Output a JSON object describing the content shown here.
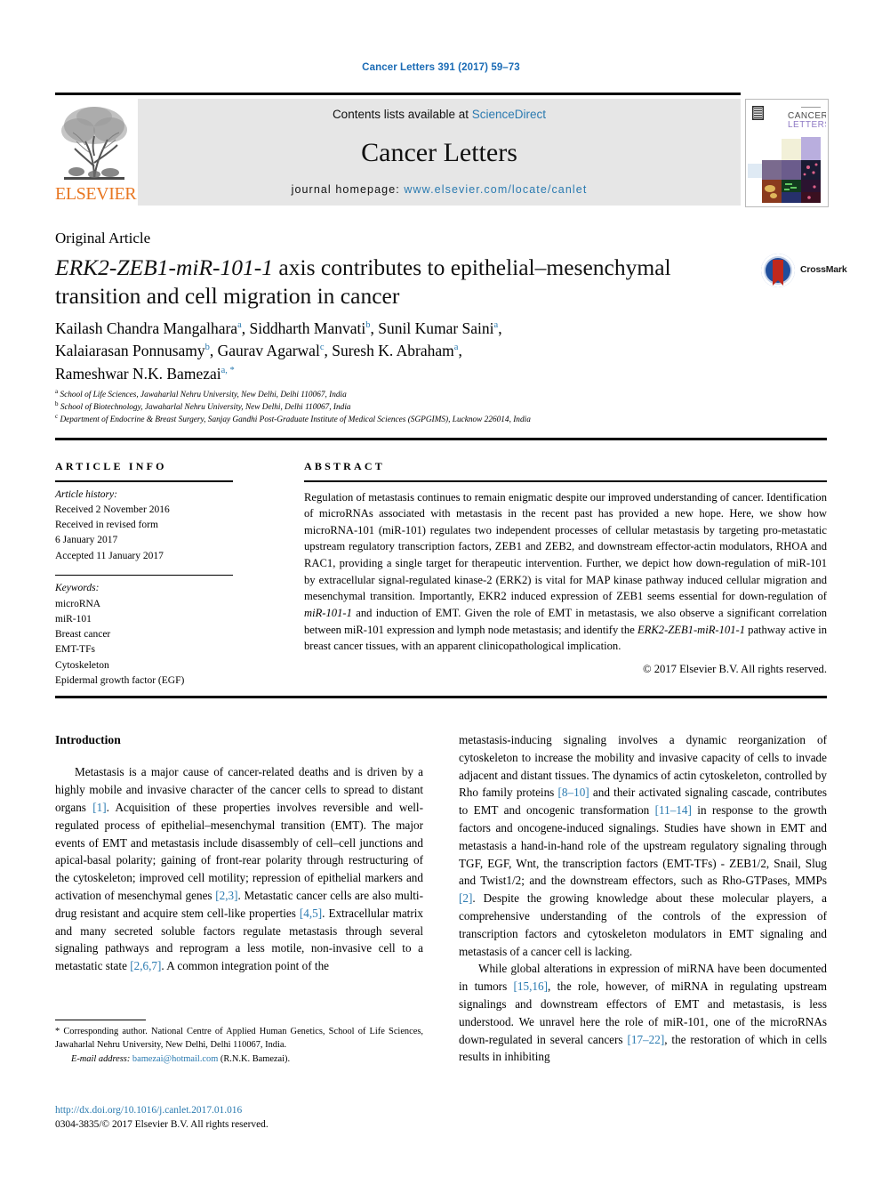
{
  "running_head": "Cancer Letters 391 (2017) 59–73",
  "masthead": {
    "contents_prefix": "Contents lists available at ",
    "contents_link": "ScienceDirect",
    "journal_title": "Cancer Letters",
    "homepage_prefix": "journal homepage: ",
    "homepage_url": "www.elsevier.com/locate/canlet",
    "publisher": "ELSEVIER",
    "cover_title_line1": "CANCER",
    "cover_title_line2": "LETTERS"
  },
  "article": {
    "type": "Original Article",
    "title_italic": "ERK2-ZEB1-miR-101-1",
    "title_rest": " axis contributes to epithelial–mesenchymal transition and cell migration in cancer",
    "crossmark_label": "CrossMark"
  },
  "authors": [
    {
      "name": "Kailash Chandra Mangalhara",
      "sup": "a"
    },
    {
      "name": "Siddharth Manvati",
      "sup": "b"
    },
    {
      "name": "Sunil Kumar Saini",
      "sup": "a"
    },
    {
      "name": "Kalaiarasan Ponnusamy",
      "sup": "b"
    },
    {
      "name": "Gaurav Agarwal",
      "sup": "c"
    },
    {
      "name": "Suresh K. Abraham",
      "sup": "a"
    },
    {
      "name": "Rameshwar N.K. Bamezai",
      "sup": "a, *"
    }
  ],
  "affiliations": [
    {
      "marker": "a",
      "text": "School of Life Sciences, Jawaharlal Nehru University, New Delhi, Delhi 110067, India"
    },
    {
      "marker": "b",
      "text": "School of Biotechnology, Jawaharlal Nehru University, New Delhi, Delhi 110067, India"
    },
    {
      "marker": "c",
      "text": "Department of Endocrine & Breast Surgery, Sanjay Gandhi Post-Graduate Institute of Medical Sciences (SGPGIMS), Lucknow 226014, India"
    }
  ],
  "article_info": {
    "heading": "ARTICLE INFO",
    "history_label": "Article history:",
    "history": [
      "Received 2 November 2016",
      "Received in revised form",
      "6 January 2017",
      "Accepted 11 January 2017"
    ],
    "keywords_label": "Keywords:",
    "keywords": [
      "microRNA",
      "miR-101",
      "Breast cancer",
      "EMT-TFs",
      "Cytoskeleton",
      "Epidermal growth factor (EGF)"
    ]
  },
  "abstract": {
    "heading": "ABSTRACT",
    "part1": "Regulation of metastasis continues to remain enigmatic despite our improved understanding of cancer. Identification of microRNAs associated with metastasis in the recent past has provided a new hope. Here, we show how microRNA-101 (miR-101) regulates two independent processes of cellular metastasis by targeting pro-metastatic upstream regulatory transcription factors, ZEB1 and ZEB2, and downstream effector-actin modulators, RHOA and RAC1, providing a single target for therapeutic intervention. Further, we depict how down-regulation of miR-101 by extracellular signal-regulated kinase-2 (ERK2) is vital for MAP kinase pathway induced cellular migration and mesenchymal transition. Importantly, EKR2 induced expression of ZEB1 seems essential for down-regulation of ",
    "italic1": "miR-101-1",
    "part2": " and induction of EMT. Given the role of EMT in metastasis, we also observe a significant correlation between miR-101 expression and lymph node metastasis; and identify the ",
    "italic2": "ERK2-ZEB1-miR-101-1",
    "part3": " pathway active in breast cancer tissues, with an apparent clinicopathological implication.",
    "copyright": "© 2017 Elsevier B.V. All rights reserved."
  },
  "body": {
    "section_title": "Introduction",
    "left_paragraph_1": {
      "s1": "Metastasis is a major cause of cancer-related deaths and is driven by a highly mobile and invasive character of the cancer cells to spread to distant organs ",
      "r1": "[1]",
      "s2": ". Acquisition of these properties involves reversible and well-regulated process of epithelial–mesenchymal transition (EMT). The major events of EMT and metastasis include disassembly of cell–cell junctions and apical-basal polarity; gaining of front-rear polarity through restructuring of the cytoskeleton; improved cell motility; repression of epithelial markers and activation of mesenchymal genes ",
      "r2": "[2,3]",
      "s3": ". Metastatic cancer cells are also multi-drug resistant and acquire stem cell-like properties ",
      "r3": "[4,5]",
      "s4": ". Extracellular matrix and many secreted soluble factors regulate metastasis through several signaling pathways and reprogram a less motile, non-invasive cell to a metastatic state ",
      "r4": "[2,6,7]",
      "s5": ". A common integration point of the"
    },
    "right_paragraph_1": {
      "s1": "metastasis-inducing signaling involves a dynamic reorganization of cytoskeleton to increase the mobility and invasive capacity of cells to invade adjacent and distant tissues. The dynamics of actin cytoskeleton, controlled by Rho family proteins ",
      "r1": "[8–10]",
      "s2": " and their activated signaling cascade, contributes to EMT and oncogenic transformation ",
      "r2": "[11–14]",
      "s3": " in response to the growth factors and oncogene-induced signalings. Studies have shown in EMT and metastasis a hand-in-hand role of the upstream regulatory signaling through TGF, EGF, Wnt, the transcription factors (EMT-TFs) - ZEB1/2, Snail, Slug and Twist1/2; and the downstream effectors, such as Rho-GTPases, MMPs ",
      "r3": "[2]",
      "s4": ". Despite the growing knowledge about these molecular players, a comprehensive understanding of the controls of the expression of transcription factors and cytoskeleton modulators in EMT signaling and metastasis of a cancer cell is lacking."
    },
    "right_paragraph_2": {
      "s1": "While global alterations in expression of miRNA have been documented in tumors ",
      "r1": "[15,16]",
      "s2": ", the role, however, of miRNA in regulating upstream signalings and downstream effectors of EMT and metastasis, is less understood. We unravel here the role of miR-101, one of the microRNAs down-regulated in several cancers ",
      "r2": "[17–22]",
      "s3": ", the restoration of which in cells results in inhibiting"
    }
  },
  "footnote": {
    "marker": "*",
    "text": " Corresponding author. National Centre of Applied Human Genetics, School of Life Sciences, Jawaharlal Nehru University, New Delhi, Delhi 110067, India.",
    "email_label": "E-mail address:",
    "email": "bamezai@hotmail.com",
    "email_owner": " (R.N.K. Bamezai)."
  },
  "footer": {
    "doi": "http://dx.doi.org/10.1016/j.canlet.2017.01.016",
    "issn_line": "0304-3835/© 2017 Elsevier B.V. All rights reserved."
  },
  "colors": {
    "link": "#2a7ab0",
    "elsevier_orange": "#e87722",
    "banner_gray": "#e6e6e6",
    "crossmark_blue": "#1f4e9c",
    "crossmark_red": "#c0281c"
  }
}
